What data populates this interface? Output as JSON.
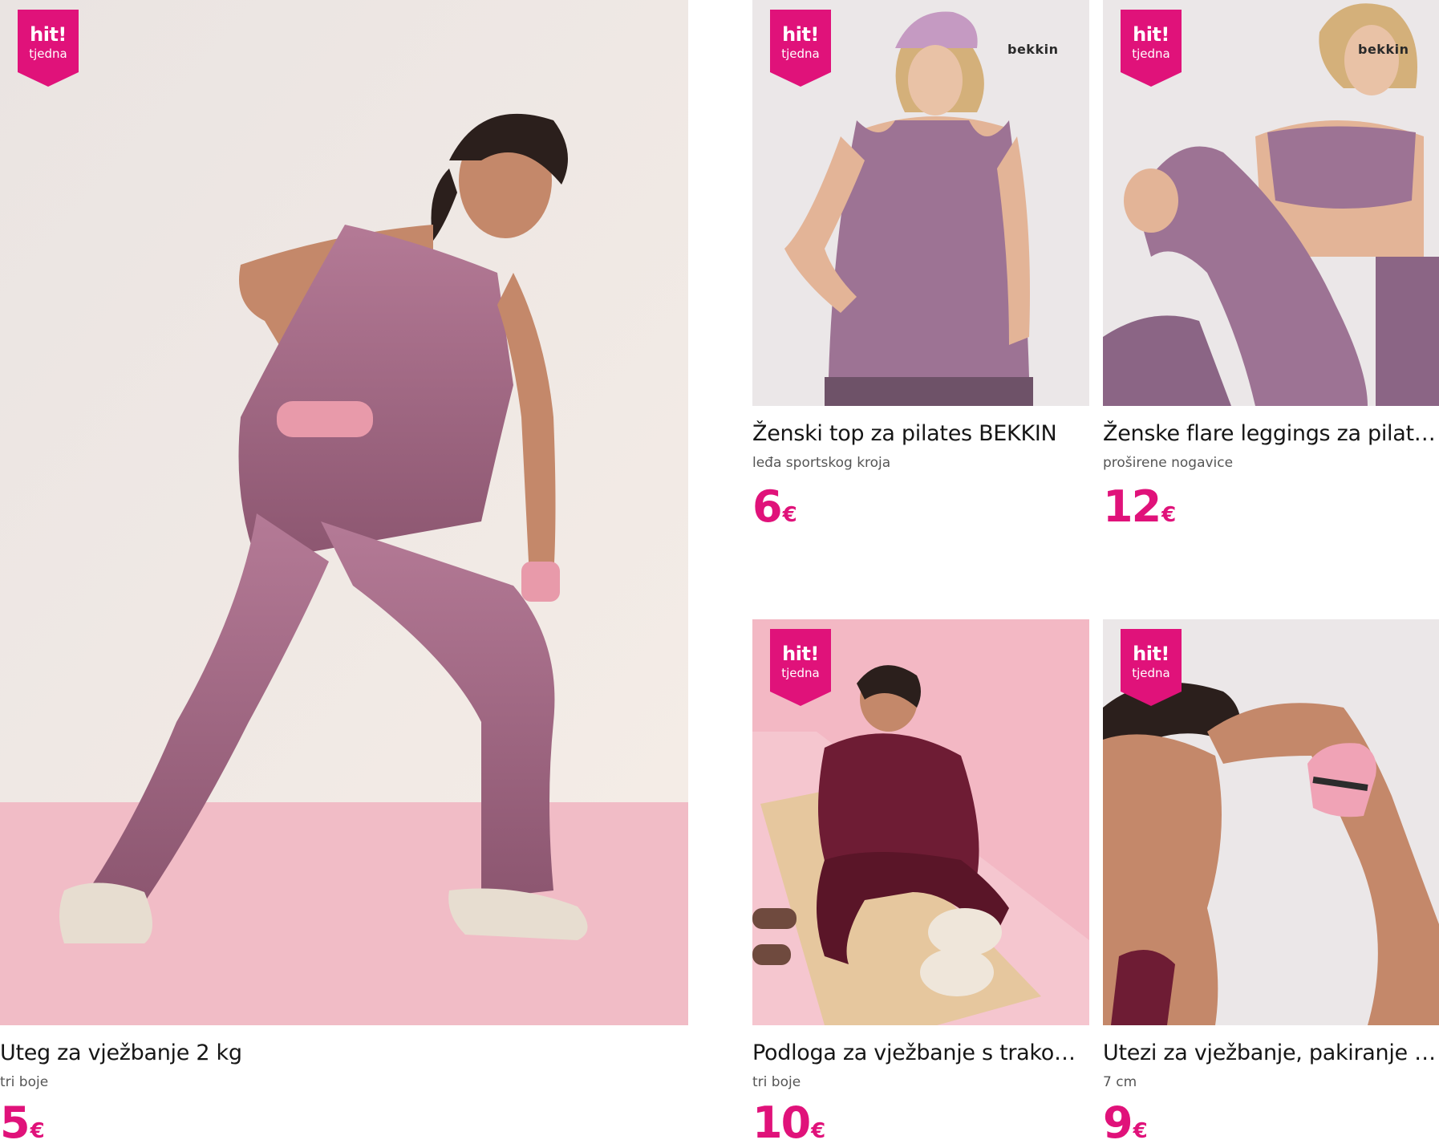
{
  "badge": {
    "line1": "hit!",
    "line2": "tjedna",
    "color": "#e0127a"
  },
  "brand_logo": "bekkin",
  "accent_color": "#e0127a",
  "products": [
    {
      "title": "Uteg za vježbanje 2 kg",
      "subtitle": "tri boje",
      "price": "5",
      "currency": "€"
    },
    {
      "title": "Ženski top za pilates BEKKIN",
      "subtitle": "leđa sportskog kroja",
      "price": "6",
      "currency": "€"
    },
    {
      "title": "Ženske flare leggings za pilate...",
      "subtitle": "proširene nogavice",
      "price": "12",
      "currency": "€"
    },
    {
      "title": "Podloga za vježbanje s trakom...",
      "subtitle": "tri boje",
      "price": "10",
      "currency": "€"
    },
    {
      "title": "Utezi za vježbanje, pakiranje o...",
      "subtitle": "7 cm",
      "price": "9",
      "currency": "€"
    }
  ]
}
